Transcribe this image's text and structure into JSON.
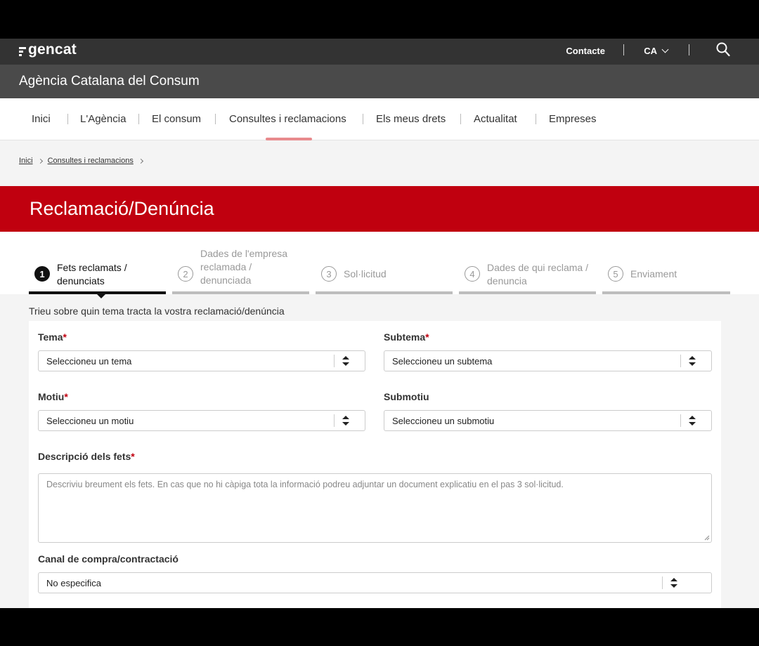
{
  "header": {
    "logo_text": "gencat",
    "contact_label": "Contacte",
    "language_label": "CA"
  },
  "agency": {
    "name": "Agència Catalana del Consum"
  },
  "nav": {
    "items": [
      {
        "label": "Inici"
      },
      {
        "label": "L'Agència"
      },
      {
        "label": "El consum"
      },
      {
        "label": "Consultes i reclamacions",
        "active": true
      },
      {
        "label": "Els meus drets"
      },
      {
        "label": "Actualitat"
      },
      {
        "label": "Empreses"
      }
    ]
  },
  "breadcrumb": {
    "items": [
      "Inici",
      "Consultes i reclamacions"
    ]
  },
  "page_title": "Reclamació/Denúncia",
  "stepper": {
    "steps": [
      {
        "number": "1",
        "line1": "Fets reclamats /",
        "line2": "denunciats",
        "line3": "",
        "active": true
      },
      {
        "number": "2",
        "line1": "Dades de l'empresa",
        "line2": "reclamada /",
        "line3": "denunciada",
        "active": false
      },
      {
        "number": "3",
        "line1": "Sol·licitud",
        "line2": "",
        "line3": "",
        "active": false
      },
      {
        "number": "4",
        "line1": "Dades de qui reclama /",
        "line2": "denuncia",
        "line3": "",
        "active": false
      },
      {
        "number": "5",
        "line1": "Enviament",
        "line2": "",
        "line3": "",
        "active": false
      }
    ]
  },
  "form": {
    "intro": "Trieu sobre quin tema tracta la vostra reclamació/denúncia",
    "required_marker": "*",
    "tema": {
      "label": "Tema",
      "value": "Seleccioneu un tema"
    },
    "subtema": {
      "label": "Subtema",
      "value": "Seleccioneu un subtema"
    },
    "motiu": {
      "label": "Motiu",
      "value": "Seleccioneu un motiu"
    },
    "submotiu": {
      "label": "Submotiu",
      "value": "Seleccioneu un submotiu"
    },
    "descripcio": {
      "label": "Descripció dels fets",
      "placeholder": "Descriviu breument els fets. En cas que no hi càpiga tota la informació podreu adjuntar un document explicatiu en el pas 3 sol·licitud."
    },
    "canal": {
      "label": "Canal de compra/contractació",
      "value": "No especifica"
    }
  },
  "colors": {
    "brand_red": "#c0000f",
    "topbar": "#333333",
    "agency_bar": "#4a4a4a",
    "nav_active_underline": "#e88a8d"
  }
}
